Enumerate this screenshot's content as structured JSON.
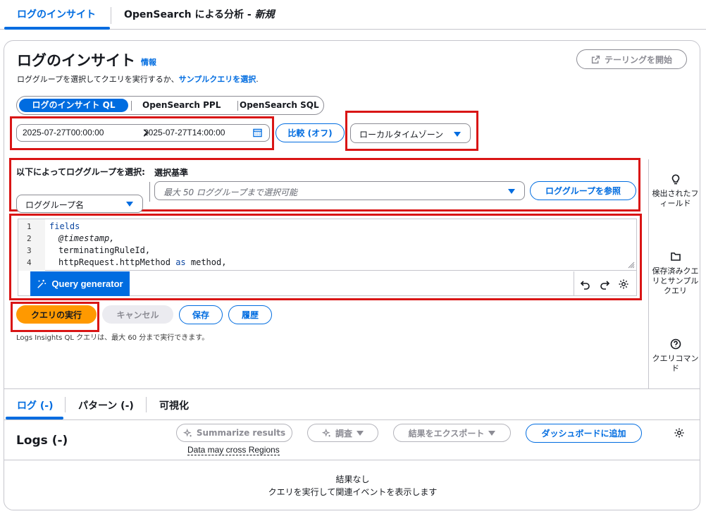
{
  "top_tabs": {
    "insights": "ログのインサイト",
    "opensearch_prefix": "OpenSearch による分析 - ",
    "opensearch_new": "新規"
  },
  "header": {
    "title": "ログのインサイト",
    "info": "情報",
    "subtitle_prefix": "ロググループを選択してクエリを実行するか、",
    "subtitle_link": "サンプルクエリを選択",
    "subtitle_suffix": ".",
    "tail_button": "テーリングを開始"
  },
  "query_languages": {
    "items": [
      "ログのインサイト QL",
      "OpenSearch PPL",
      "OpenSearch SQL"
    ],
    "selected": "ログのインサイト QL"
  },
  "time_range": {
    "start": "2025-07-27T00:00:00",
    "end": "2025-07-27T14:00:00",
    "compare_button": "比較 (オフ)",
    "timezone": "ローカルタイムゾーン"
  },
  "log_groups": {
    "select_by_label": "以下によってロググループを選択:",
    "select_by_value": "ロググループ名",
    "criteria_label": "選択基準",
    "criteria_placeholder": "最大 50 ロググループまで選択可能",
    "browse_button": "ロググループを参照"
  },
  "editor": {
    "line_numbers": [
      "1",
      "2",
      "3",
      "4"
    ],
    "lines": {
      "l1": "fields",
      "l2": "@timestamp,",
      "l3": "terminatingRuleId,",
      "l4_a": "httpRequest.httpMethod",
      "l4_kw": "as",
      "l4_b": "method,"
    },
    "query_generator": "Query generator"
  },
  "actions": {
    "run": "クエリの実行",
    "cancel": "キャンセル",
    "save": "保存",
    "history": "履歴",
    "note": "Logs Insights QL クエリは、最大 60 分まで実行できます。"
  },
  "side_panel": {
    "discovered_fields": "検出されたフィールド",
    "saved_queries": "保存済みクエリとサンプルクエリ",
    "query_commands": "クエリコマンド"
  },
  "results": {
    "tabs": [
      "ログ (-)",
      "パターン (-)",
      "可視化"
    ],
    "active_tab": "ログ (-)",
    "title": "Logs (-)",
    "summarize": "Summarize results",
    "investigate": "調査",
    "export": "結果をエクスポート",
    "add_dashboard": "ダッシュボードに追加",
    "cross_regions": "Data may cross Regions",
    "empty_title": "結果なし",
    "empty_sub": "クエリを実行して関連イベントを表示します"
  },
  "colors": {
    "accent": "#006ce0",
    "primary_button": "#ff9900",
    "highlight_box": "#d91515"
  }
}
